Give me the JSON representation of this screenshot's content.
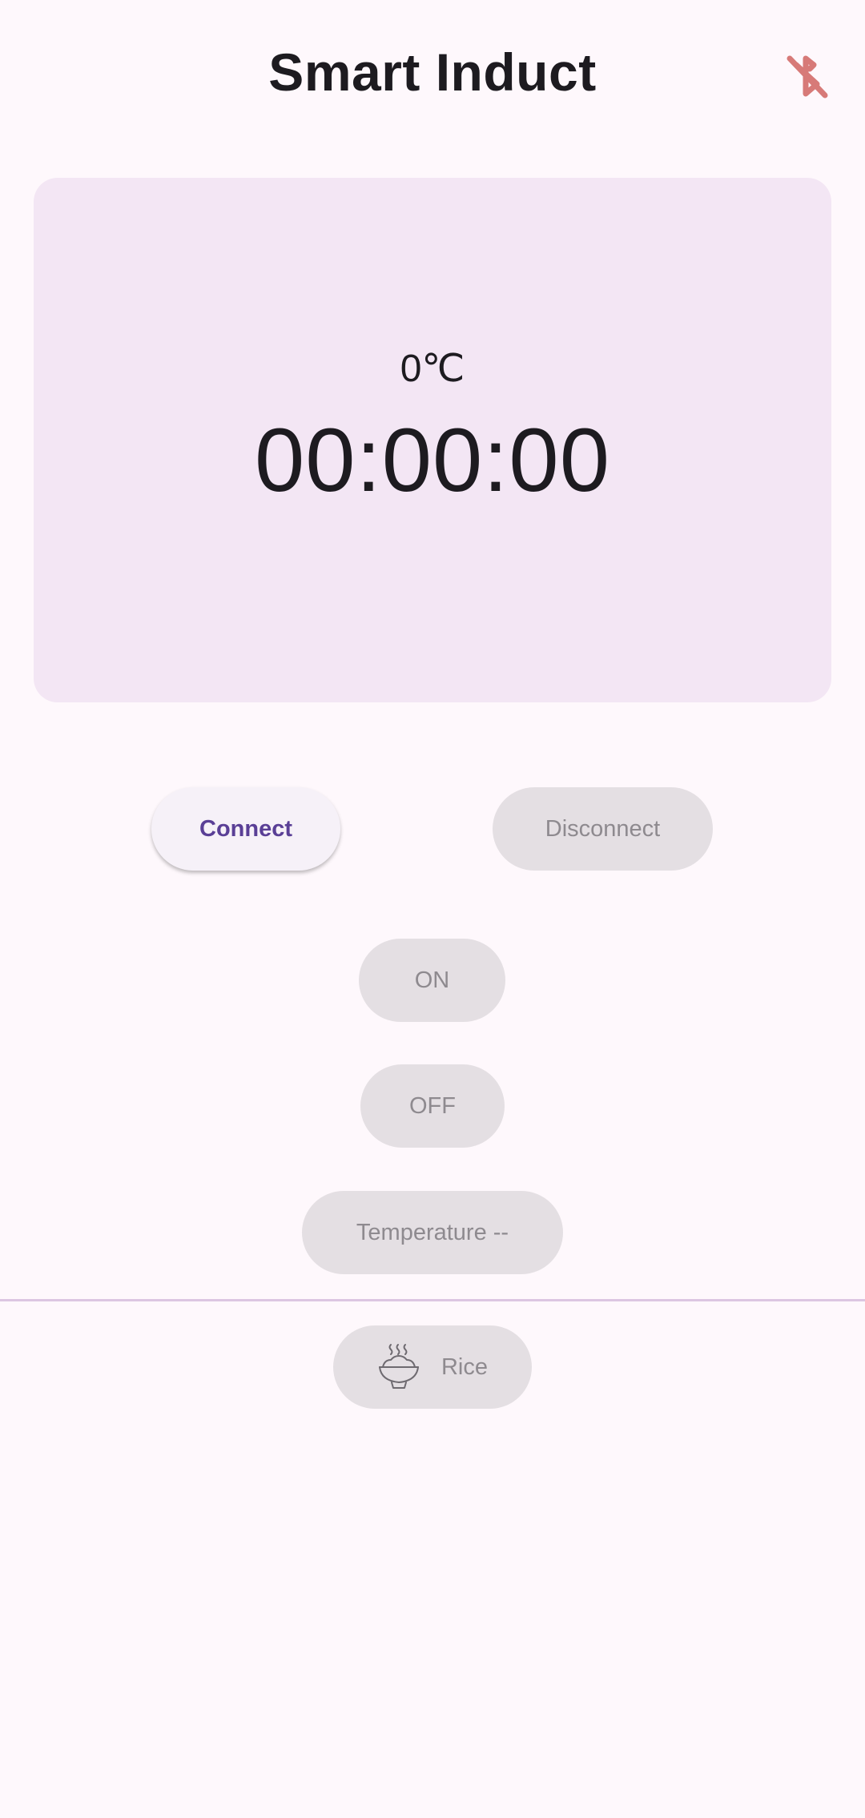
{
  "app_bar": {
    "title": "Smart Induct",
    "bluetooth_icon": "bluetooth-disabled-icon",
    "bluetooth_icon_color": "#d77a78"
  },
  "display": {
    "temperature": "0℃",
    "timer": "00:00:00",
    "background_color": "#f3e6f4"
  },
  "buttons": {
    "connect_label": "Connect",
    "disconnect_label": "Disconnect",
    "on_label": "ON",
    "off_label": "OFF",
    "temperature_label": "Temperature --",
    "rice_label": "Rice",
    "rice_icon": "rice-bowl-icon"
  },
  "colors": {
    "accent": "#5a3f96",
    "disabled_bg": "#e4dfe3",
    "disabled_text": "#8e8a8f",
    "divider": "#dcc6e2"
  }
}
